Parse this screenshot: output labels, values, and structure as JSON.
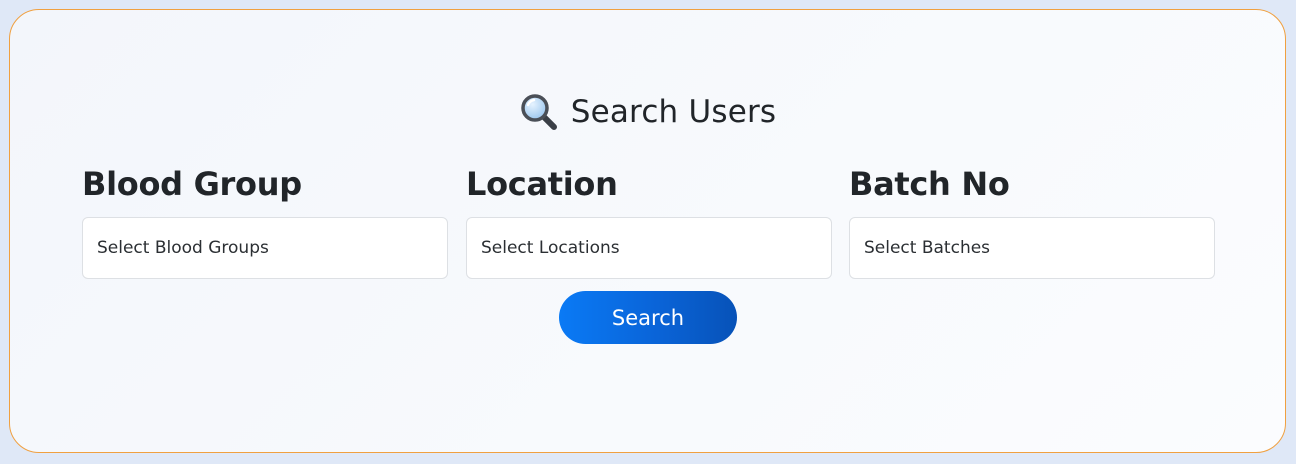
{
  "header": {
    "icon": "magnifying-glass-icon",
    "title": "Search Users"
  },
  "filters": [
    {
      "label": "Blood Group",
      "placeholder": "Select Blood Groups"
    },
    {
      "label": "Location",
      "placeholder": "Select Locations"
    },
    {
      "label": "Batch No",
      "placeholder": "Select Batches"
    }
  ],
  "actions": {
    "search_label": "Search"
  },
  "colors": {
    "panel_border": "#f0a040",
    "button_start": "#0a7af5",
    "button_end": "#0752b8",
    "text": "#212529"
  }
}
